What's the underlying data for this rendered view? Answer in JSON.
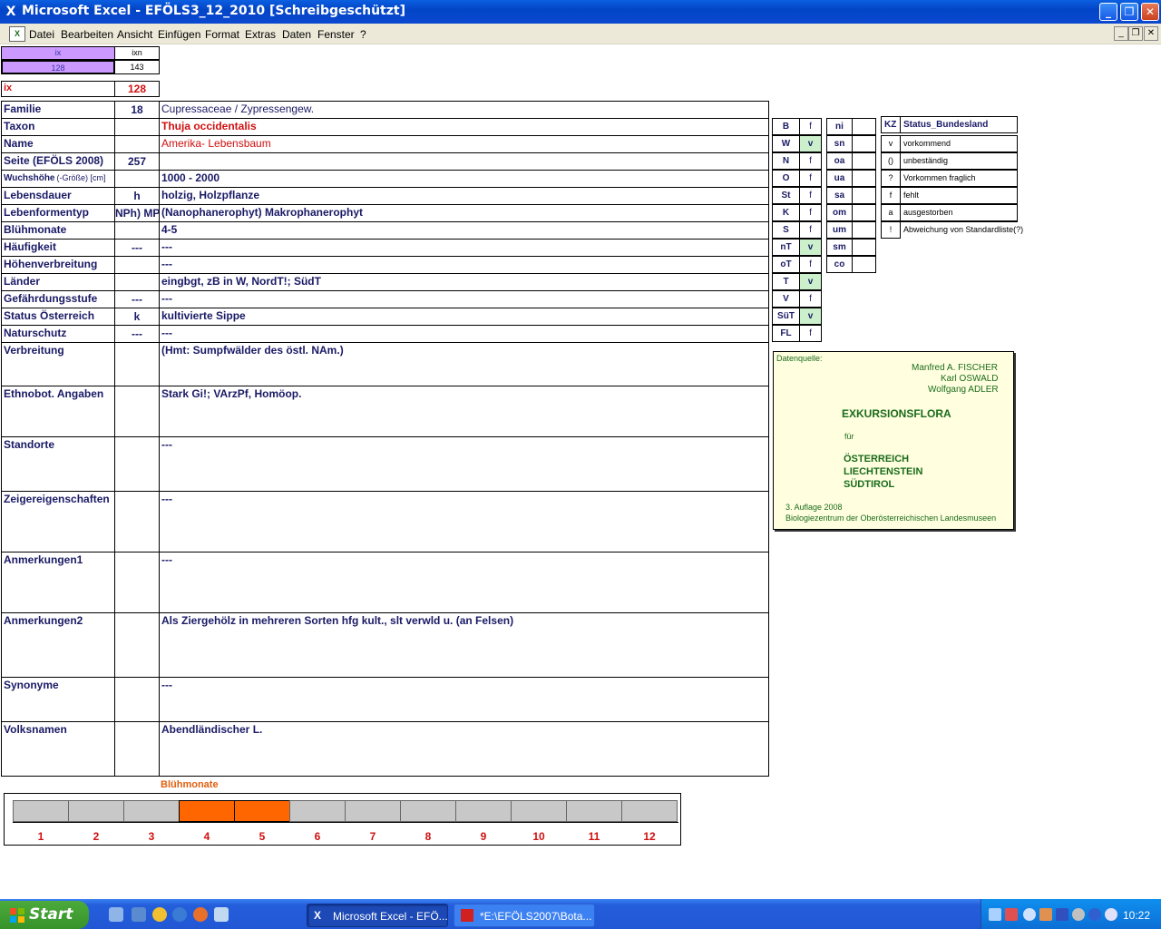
{
  "window": {
    "title": "Microsoft Excel - EFÖLS3_12_2010  [Schreibgeschützt]",
    "min_glyph": "_",
    "max_glyph": "❐",
    "close_glyph": "✕"
  },
  "menu": {
    "items": [
      "Datei",
      "Bearbeiten",
      "Ansicht",
      "Einfügen",
      "Format",
      "Extras",
      "Daten",
      "Fenster",
      "?"
    ],
    "mdi_min": "_",
    "mdi_restore": "❐",
    "mdi_close": "✕"
  },
  "index": {
    "ix_header": "ix",
    "ixn_header": "ixn",
    "ix_small": "128",
    "ixn_small": "143",
    "ix_label": "ix",
    "ix_value": "128"
  },
  "rows": [
    {
      "label": "Familie",
      "code": "18",
      "value": "Cupressaceae / Zypressengew."
    },
    {
      "label": "Taxon",
      "code": "",
      "value": "Thuja occidentalis"
    },
    {
      "label": "Name",
      "code": "",
      "value": "Amerika- Lebensbaum"
    },
    {
      "label": "Seite (EFÖLS 2008)",
      "code": "257",
      "value": ""
    },
    {
      "label": "Wuchshöhe",
      "label_suffix": "(-Größe) [cm]",
      "code": "",
      "value": "1000 - 2000"
    },
    {
      "label": "Lebensdauer",
      "code": "h",
      "value": "holzig, Holzpflanze"
    },
    {
      "label": "Lebenformentyp",
      "code": "NPh) MPh",
      "value": "(Nanophanerophyt) Makrophanerophyt"
    },
    {
      "label": "Blühmonate",
      "code": "",
      "value": "4-5"
    },
    {
      "label": "Häufigkeit",
      "code": "---",
      "value": "---"
    },
    {
      "label": "Höhenverbreitung",
      "code": "",
      "value": "---"
    },
    {
      "label": "Länder",
      "code": "",
      "value": "eingbgt, zB in W, NordT!; SüdT"
    },
    {
      "label": "Gefährdungsstufe",
      "code": "---",
      "value": "---"
    },
    {
      "label": "Status Österreich",
      "code": "k",
      "value": "kultivierte Sippe"
    },
    {
      "label": "Naturschutz",
      "code": "---",
      "value": "---"
    },
    {
      "label": "Verbreitung",
      "code": "",
      "value": "(Hmt: Sumpfwälder des östl. NAm.)"
    },
    {
      "label": "Ethnobot. Angaben",
      "code": "",
      "value": "Stark Gi!; VArzPf, Homöop."
    },
    {
      "label": "Standorte",
      "code": "",
      "value": "---"
    },
    {
      "label": "Zeigereigenschaften",
      "code": "",
      "value": "---"
    },
    {
      "label": "Anmerkungen1",
      "code": "",
      "value": "---"
    },
    {
      "label": "Anmerkungen2",
      "code": "",
      "value": "Als Ziergehölz in mehreren Sorten hfg kult., slt verwld u. (an Felsen)"
    },
    {
      "label": "Synonyme",
      "code": "",
      "value": "---"
    },
    {
      "label": "Volksnamen",
      "code": "",
      "value": "Abendländischer L."
    }
  ],
  "laender": [
    {
      "code": "B",
      "status": "f"
    },
    {
      "code": "W",
      "status": "v"
    },
    {
      "code": "N",
      "status": "f"
    },
    {
      "code": "O",
      "status": "f"
    },
    {
      "code": "St",
      "status": "f"
    },
    {
      "code": "K",
      "status": "f"
    },
    {
      "code": "S",
      "status": "f"
    },
    {
      "code": "nT",
      "status": "v"
    },
    {
      "code": "oT",
      "status": "f"
    },
    {
      "code": "T",
      "status": "v"
    },
    {
      "code": "V",
      "status": "f"
    },
    {
      "code": "SüT",
      "status": "v"
    },
    {
      "code": "FL",
      "status": "f"
    }
  ],
  "hoehe": [
    {
      "code": "ni"
    },
    {
      "code": "sn"
    },
    {
      "code": "oa"
    },
    {
      "code": "ua"
    },
    {
      "code": "sa"
    },
    {
      "code": "om"
    },
    {
      "code": "um"
    },
    {
      "code": "sm"
    },
    {
      "code": "co"
    }
  ],
  "kz_legend": {
    "header_kz": "KZ",
    "header_status": "Status_Bundesland",
    "entries": [
      {
        "kz": "v",
        "text": "vorkommend"
      },
      {
        "kz": "()",
        "text": "unbeständig"
      },
      {
        "kz": "?",
        "text": "Vorkommen fraglich"
      },
      {
        "kz": "f",
        "text": "fehlt"
      },
      {
        "kz": "a",
        "text": "ausgestorben"
      },
      {
        "kz": "!",
        "text": "Abweichung von Standardliste(?)"
      }
    ]
  },
  "source": {
    "label": "Datenquelle:",
    "author1": "Manfred A. FISCHER",
    "author2": "Karl OSWALD",
    "author3": "Wolfgang ADLER",
    "title": "EXKURSIONSFLORA",
    "fuer": "für",
    "country1": "ÖSTERREICH",
    "country2": "LIECHTENSTEIN",
    "country3": "SÜDTIROL",
    "edition": "3. Auflage 2008",
    "publisher": "Biologiezentrum der Oberösterreichischen Landesmuseen"
  },
  "chart_data": {
    "type": "bar",
    "title": "Blühmonate",
    "categories": [
      "1",
      "2",
      "3",
      "4",
      "5",
      "6",
      "7",
      "8",
      "9",
      "10",
      "11",
      "12"
    ],
    "values": [
      0,
      0,
      0,
      1,
      1,
      0,
      0,
      0,
      0,
      0,
      0,
      0
    ],
    "colors": {
      "on": "#ff6600",
      "off": "#c8c8c8"
    }
  },
  "taskbar": {
    "start_label": "Start",
    "tasks": [
      "Microsoft Excel - EFÖ...",
      "*E:\\EFÖLS2007\\Bota..."
    ],
    "clock": "10:22"
  }
}
